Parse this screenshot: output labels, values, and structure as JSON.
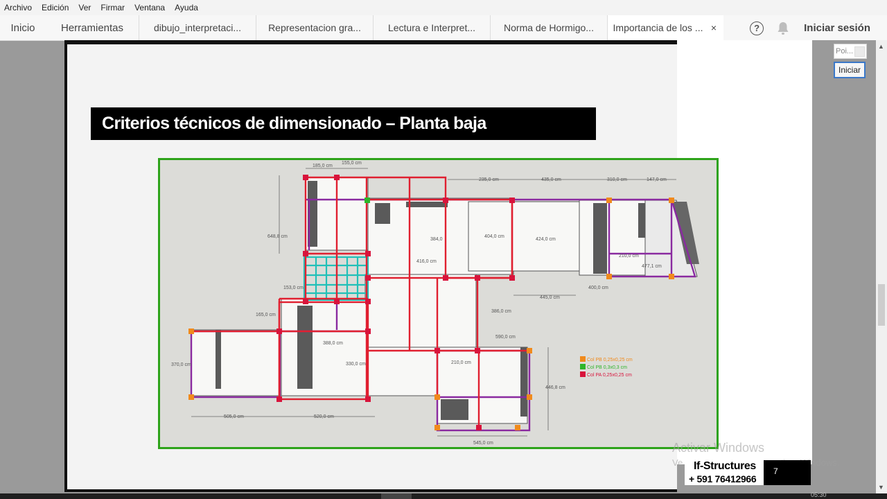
{
  "menu": [
    "Archivo",
    "Edición",
    "Ver",
    "Firmar",
    "Ventana",
    "Ayuda"
  ],
  "tabs": {
    "home": "Inicio",
    "tools": "Herramientas",
    "docs": [
      {
        "label": "dibujo_interpretaci..."
      },
      {
        "label": "Representacion gra..."
      },
      {
        "label": "Lectura e Interpret..."
      },
      {
        "label": "Norma de Hormigo..."
      },
      {
        "label": "Importancia de los ..."
      }
    ],
    "close_glyph": "×",
    "help_glyph": "?",
    "sign_in": "Iniciar sesión"
  },
  "slide": {
    "title": "Criterios técnicos de dimensionado – Planta baja",
    "page_number": "7"
  },
  "plan": {
    "dimensions": [
      "185,0 cm",
      "155,0 cm",
      "235,0 cm",
      "435,0 cm",
      "310,0 cm",
      "147,0 cm",
      "648,8 cm",
      "404,0 cm",
      "424,0 cm",
      "384,0",
      "416,0 cm",
      "210,0 cm",
      "477,1 cm",
      "153,0 cm",
      "445,0 cm",
      "400,0 cm",
      "165,0 cm",
      "386,0 cm",
      "388,0 cm",
      "370,0 cm",
      "330,0 cm",
      "210,0 cm",
      "446,8 cm",
      "505,0 cm",
      "520,0 cm",
      "590,0 cm",
      "545,0 cm"
    ],
    "legend": [
      {
        "label": "Col PB 0,25x0,25 cm",
        "color": "#f08a1c"
      },
      {
        "label": "Col PB 0,3x0,3 cm",
        "color": "#2fb52a"
      },
      {
        "label": "Col PA 0,25x0,25 cm",
        "color": "#d8143c"
      }
    ],
    "colors": {
      "beam_red": "#e02030",
      "beam_purple": "#8a2aa0",
      "stair": "#22c0b8",
      "frame": "#2ea31a"
    }
  },
  "side_panel": {
    "search_placeholder": "Poi...",
    "button": "Iniciar"
  },
  "watermark": {
    "line1": "Activar Windows",
    "line2": "Ve a Configuración para activar Windows."
  },
  "brand": {
    "name": "If-Structures",
    "phone": "+ 591 76412966"
  },
  "taskbar": {
    "clock": "05:30"
  }
}
